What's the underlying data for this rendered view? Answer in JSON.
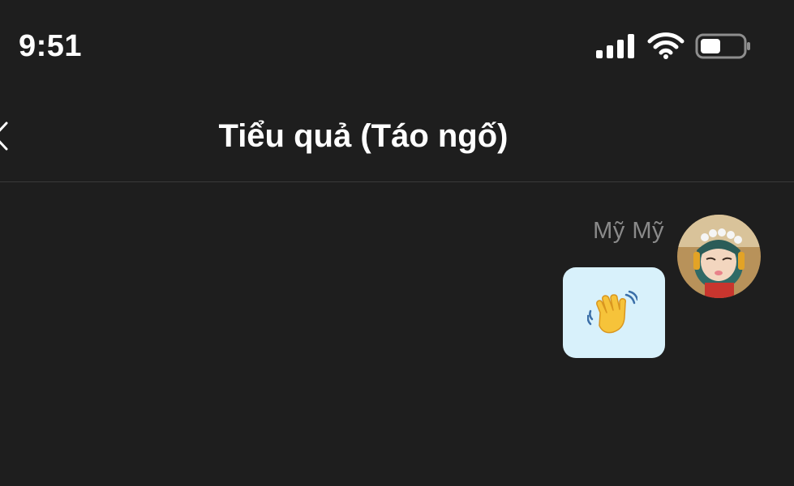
{
  "status_bar": {
    "time": "9:51",
    "signal_icon": "cellular-signal-icon",
    "wifi_icon": "wifi-icon",
    "battery_icon": "battery-icon"
  },
  "nav": {
    "back_icon": "back-chevron-icon",
    "title": "Tiểu quả (Táo ngố)"
  },
  "messages": [
    {
      "sender": "Mỹ Mỹ",
      "avatar_icon": "avatar-icon",
      "content_icon": "waving-hand-icon"
    }
  ],
  "colors": {
    "background": "#1e1e1e",
    "bubble": "#d8f1fb",
    "sender_name": "#8a8a8a"
  }
}
